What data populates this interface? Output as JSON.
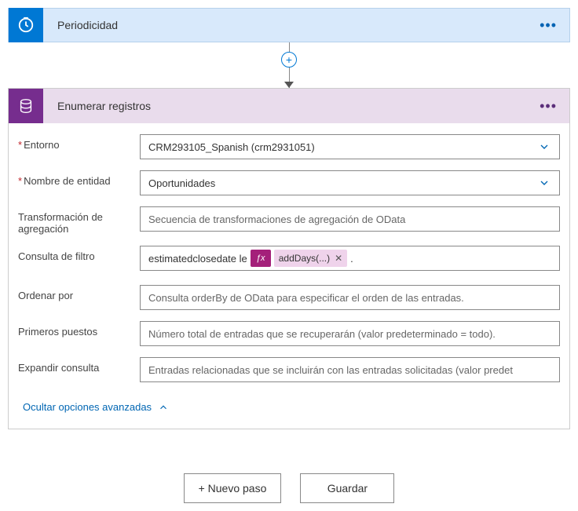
{
  "trigger": {
    "title": "Periodicidad"
  },
  "action": {
    "title": "Enumerar registros",
    "fields": {
      "entorno": {
        "label": "Entorno",
        "value": "CRM293105_Spanish (crm2931051)"
      },
      "entidad": {
        "label": "Nombre de entidad",
        "value": "Oportunidades"
      },
      "agregacion": {
        "label": "Transformación de agregación",
        "placeholder": "Secuencia de transformaciones de agregación de OData"
      },
      "filtro": {
        "label": "Consulta de filtro",
        "prefix": "estimatedclosedate le",
        "token": "addDays(...)",
        "suffix": "."
      },
      "ordenar": {
        "label": "Ordenar por",
        "placeholder": "Consulta orderBy de OData para especificar el orden de las entradas."
      },
      "primeros": {
        "label": "Primeros puestos",
        "placeholder": "Número total de entradas que se recuperarán (valor predeterminado = todo)."
      },
      "expandir": {
        "label": "Expandir consulta",
        "placeholder": "Entradas relacionadas que se incluirán con las entradas solicitadas (valor predet"
      }
    },
    "advanced_toggle": "Ocultar opciones avanzadas"
  },
  "footer": {
    "new_step": "+ Nuevo paso",
    "save": "Guardar"
  },
  "fx": "ƒx"
}
